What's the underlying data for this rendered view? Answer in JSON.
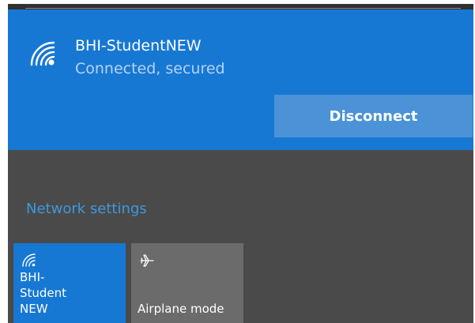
{
  "network": {
    "name": "BHI-StudentNEW",
    "status": "Connected, secured",
    "icon": "wifi-icon"
  },
  "actions": {
    "disconnect_label": "Disconnect"
  },
  "links": {
    "network_settings": "Network settings"
  },
  "quick_actions": [
    {
      "label": "BHI-StudentNEW",
      "icon": "wifi-icon",
      "active": true
    },
    {
      "label": "Airplane mode",
      "icon": "airplane-icon",
      "active": false
    }
  ],
  "colors": {
    "accent": "#1778d3",
    "accent_light": "#4b92d7",
    "link": "#3f98dd",
    "panel": "#4a4a4a",
    "tile_inactive": "#6b6b6b",
    "status_text": "#b6d3f2"
  }
}
